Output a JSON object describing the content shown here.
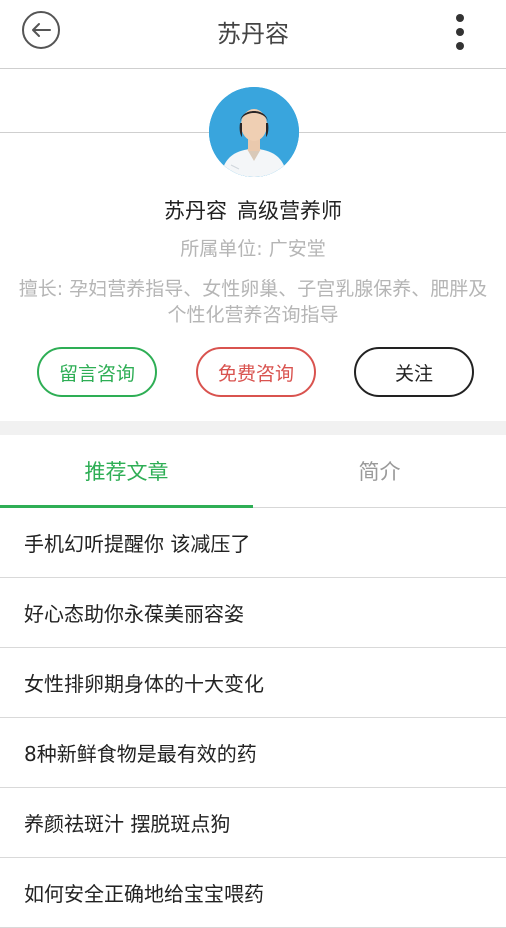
{
  "header": {
    "title": "苏丹容",
    "back_icon": "back-arrow-circle-icon",
    "more_icon": "more-vertical-icon"
  },
  "profile": {
    "name": "苏丹容",
    "position": "高级营养师",
    "unit": "所属单位: 广安堂",
    "specialty": "擅长: 孕妇营养指导、女性卵巢、子宫乳腺保养、肥胖及个性化营养咨询指导"
  },
  "actions": {
    "message": "留言咨询",
    "free": "免费咨询",
    "follow": "关注"
  },
  "tabs": [
    {
      "label": "推荐文章",
      "active": true
    },
    {
      "label": "简介",
      "active": false
    }
  ],
  "articles": [
    "手机幻听提醒你 该减压了",
    "好心态助你永葆美丽容姿",
    "女性排卵期身体的十大变化",
    "8种新鲜食物是最有效的药",
    "养颜祛斑汁 摆脱斑点狗",
    "如何安全正确地给宝宝喂药"
  ],
  "colors": {
    "accent": "#2eae55",
    "danger": "#d9534f",
    "muted": "#b5b5b5"
  }
}
